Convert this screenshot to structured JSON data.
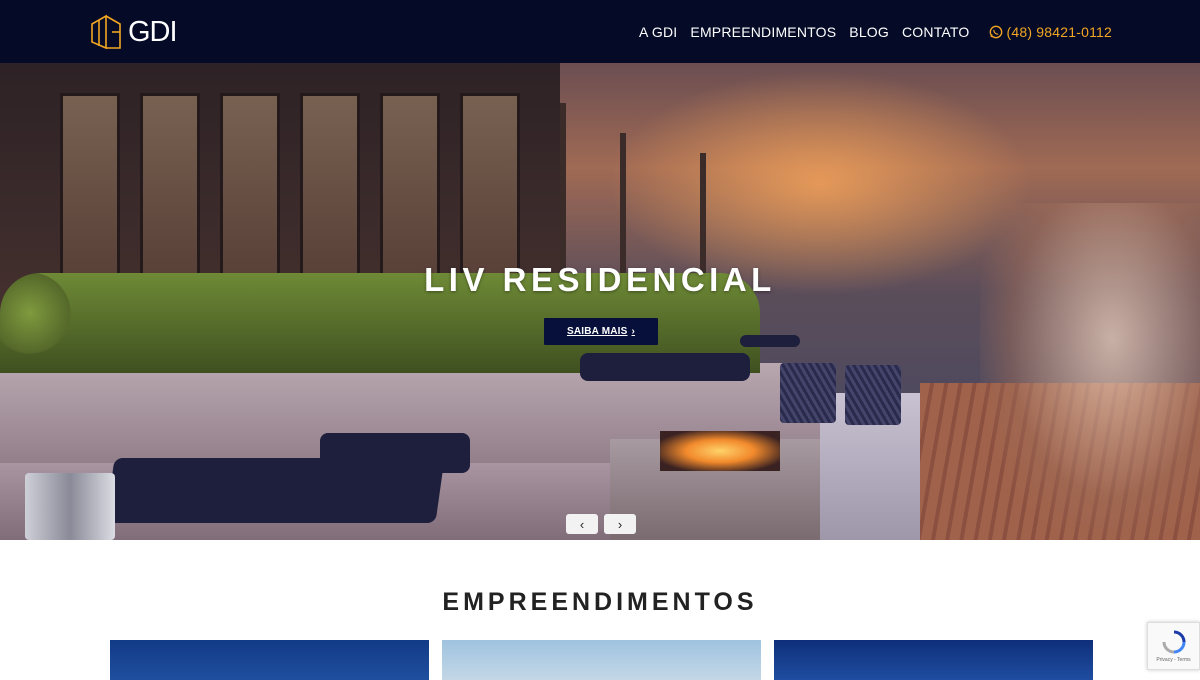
{
  "brand": {
    "name": "GDI",
    "accent_color": "#f2a623",
    "bar_color": "#050b27"
  },
  "nav": {
    "items": [
      {
        "label": "A GDI"
      },
      {
        "label": "EMPREENDIMENTOS"
      },
      {
        "label": "BLOG"
      },
      {
        "label": "CONTATO"
      }
    ],
    "phone": {
      "label": "(48) 98421-0112",
      "icon": "whatsapp-icon"
    }
  },
  "hero": {
    "title": "LIV RESIDENCIAL",
    "cta_label": "SAIBA MAIS",
    "prev_icon": "chevron-left-icon",
    "next_icon": "chevron-right-icon"
  },
  "section": {
    "title": "EMPREENDIMENTOS"
  },
  "recaptcha": {
    "text": "Privacy - Terms"
  }
}
